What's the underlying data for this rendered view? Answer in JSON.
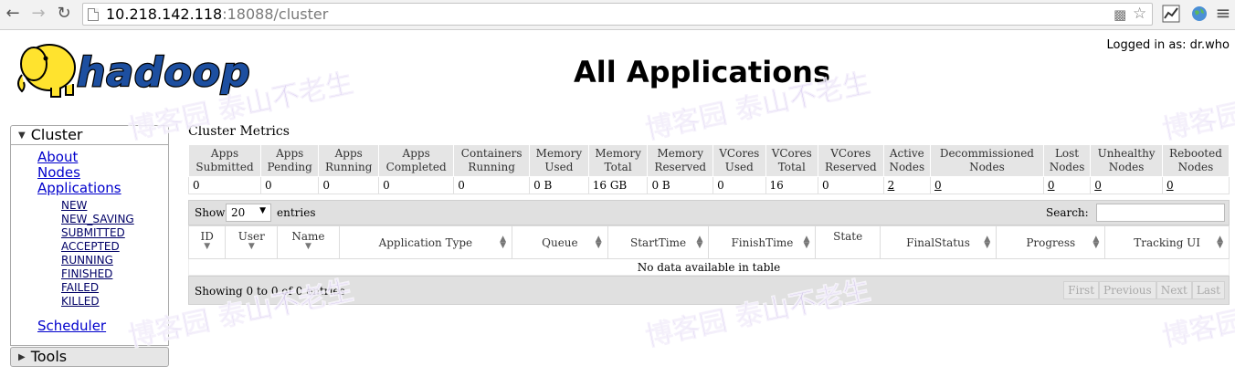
{
  "browser": {
    "url_host": "10.218.142.118",
    "url_rest": ":18088/cluster"
  },
  "header": {
    "logged_in": "Logged in as: dr.who",
    "title": "All Applications",
    "logo_text": "hadoop"
  },
  "sidebar": {
    "cluster_label": "Cluster",
    "links": [
      "About",
      "Nodes",
      "Applications"
    ],
    "app_states": [
      "NEW",
      "NEW_SAVING",
      "SUBMITTED",
      "ACCEPTED",
      "RUNNING",
      "FINISHED",
      "FAILED",
      "KILLED"
    ],
    "scheduler": "Scheduler",
    "tools_label": "Tools"
  },
  "metrics": {
    "title": "Cluster Metrics",
    "headers": [
      [
        "Apps",
        "Submitted"
      ],
      [
        "Apps",
        "Pending"
      ],
      [
        "Apps",
        "Running"
      ],
      [
        "Apps",
        "Completed"
      ],
      [
        "Containers",
        "Running"
      ],
      [
        "Memory",
        "Used"
      ],
      [
        "Memory",
        "Total"
      ],
      [
        "Memory",
        "Reserved"
      ],
      [
        "VCores",
        "Used"
      ],
      [
        "VCores",
        "Total"
      ],
      [
        "VCores",
        "Reserved"
      ],
      [
        "Active",
        "Nodes"
      ],
      [
        "Decommissioned",
        "Nodes"
      ],
      [
        "Lost",
        "Nodes"
      ],
      [
        "Unhealthy",
        "Nodes"
      ],
      [
        "Rebooted",
        "Nodes"
      ]
    ],
    "values": [
      "0",
      "0",
      "0",
      "0",
      "0",
      "0 B",
      "16 GB",
      "0 B",
      "0",
      "16",
      "0",
      "2",
      "0",
      "0",
      "0",
      "0"
    ]
  },
  "table_controls": {
    "show": "Show",
    "length": "20",
    "entries": "entries",
    "search": "Search:"
  },
  "apps_table": {
    "columns": [
      "ID",
      "User",
      "Name",
      "Application Type",
      "Queue",
      "StartTime",
      "FinishTime",
      "State",
      "FinalStatus",
      "Progress",
      "Tracking UI"
    ],
    "empty": "No data available in table",
    "info": "Showing 0 to 0 of 0 entries",
    "pagination": [
      "First",
      "Previous",
      "Next",
      "Last"
    ]
  },
  "watermark": "博客园 泰山不老生"
}
